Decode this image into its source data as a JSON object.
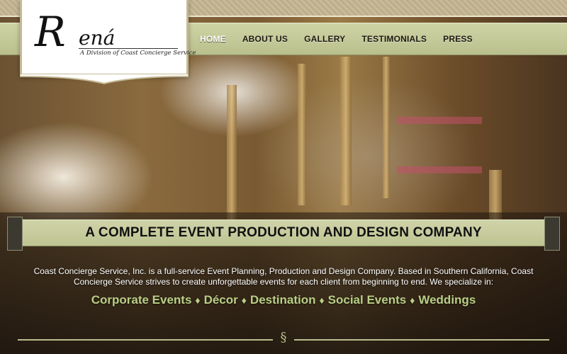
{
  "logo": {
    "initial": "R",
    "rest": "ená",
    "tagline": "A Division of Coast Concierge Service"
  },
  "nav": {
    "items": [
      {
        "label": "HOME",
        "active": true
      },
      {
        "label": "ABOUT US",
        "active": false
      },
      {
        "label": "GALLERY",
        "active": false
      },
      {
        "label": "TESTIMONIALS",
        "active": false
      },
      {
        "label": "PRESS",
        "active": false
      }
    ]
  },
  "banner": {
    "headline": "A COMPLETE EVENT PRODUCTION AND DESIGN COMPANY"
  },
  "intro": {
    "text": "Coast Concierge Service, Inc. is a full-service Event Planning, Production and Design Company. Based in Southern California, Coast Concierge Service strives to create unforgettable events for each client from beginning to end. We specialize in:"
  },
  "specialties": {
    "separator": "♦",
    "items": [
      "Corporate Events",
      "Décor",
      "Destination",
      "Social Events",
      "Weddings"
    ]
  },
  "footer": {
    "ornament": "§"
  },
  "colors": {
    "nav_bg": "#c4c99a",
    "specialty_text": "#b9cf86",
    "banner_bg": "#c7cb9d"
  }
}
